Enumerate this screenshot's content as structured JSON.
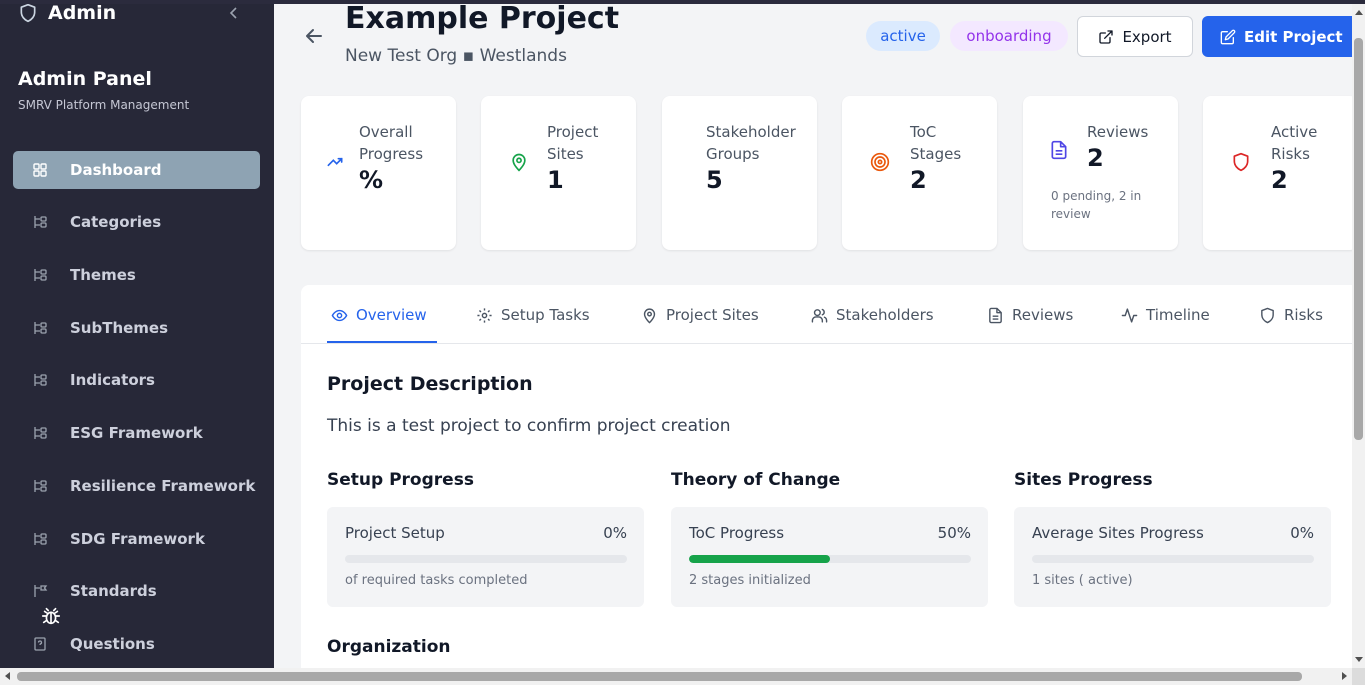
{
  "sidebar": {
    "brand": "Admin",
    "title": "Admin Panel",
    "subtitle": "SMRV Platform Management",
    "items": [
      {
        "label": "Dashboard",
        "icon": "grid-icon"
      },
      {
        "label": "Categories",
        "icon": "tree-icon"
      },
      {
        "label": "Themes",
        "icon": "tree-icon"
      },
      {
        "label": "SubThemes",
        "icon": "tree-icon"
      },
      {
        "label": "Indicators",
        "icon": "tree-icon"
      },
      {
        "label": "ESG Framework",
        "icon": "tree-icon"
      },
      {
        "label": "Resilience Framework",
        "icon": "tree-icon"
      },
      {
        "label": "SDG Framework",
        "icon": "tree-icon"
      },
      {
        "label": "Standards",
        "icon": "tree-flag-icon"
      },
      {
        "label": "Questions",
        "icon": "file-question-icon"
      }
    ]
  },
  "header": {
    "title": "Example Project",
    "org": "New Test Org",
    "separator": "▪",
    "location": "Westlands",
    "status_badge": "active",
    "phase_badge": "onboarding",
    "export_label": "Export",
    "edit_label": "Edit Project"
  },
  "stats": [
    {
      "label": "Overall Progress",
      "value": "%",
      "note": ""
    },
    {
      "label": "Project Sites",
      "value": "1",
      "note": ""
    },
    {
      "label": "Stakeholder Groups",
      "value": "5",
      "note": ""
    },
    {
      "label": "ToC Stages",
      "value": "2",
      "note": ""
    },
    {
      "label": "Reviews",
      "value": "2",
      "note": "0 pending, 2 in review"
    },
    {
      "label": "Active Risks",
      "value": "2",
      "note": ""
    }
  ],
  "tabs": [
    {
      "label": "Overview",
      "active": true
    },
    {
      "label": "Setup Tasks"
    },
    {
      "label": "Project Sites"
    },
    {
      "label": "Stakeholders"
    },
    {
      "label": "Reviews"
    },
    {
      "label": "Timeline"
    },
    {
      "label": "Risks"
    }
  ],
  "overview": {
    "description_heading": "Project Description",
    "description": "This is a test project to confirm project creation",
    "setup": {
      "heading": "Setup Progress",
      "label": "Project Setup",
      "pct": "0%",
      "value": 0,
      "note": "of required tasks completed"
    },
    "toc": {
      "heading": "Theory of Change",
      "label": "ToC Progress",
      "pct": "50%",
      "value": 50,
      "note": "2 stages initialized"
    },
    "sites": {
      "heading": "Sites Progress",
      "label": "Average Sites Progress",
      "pct": "0%",
      "value": 0,
      "note": "1 sites ( active)"
    },
    "org_heading": "Organization"
  },
  "colors": {
    "primary": "#2563eb",
    "sidebar": "#272838",
    "active_nav": "#8ea3b3",
    "progress": "#16a34a"
  }
}
